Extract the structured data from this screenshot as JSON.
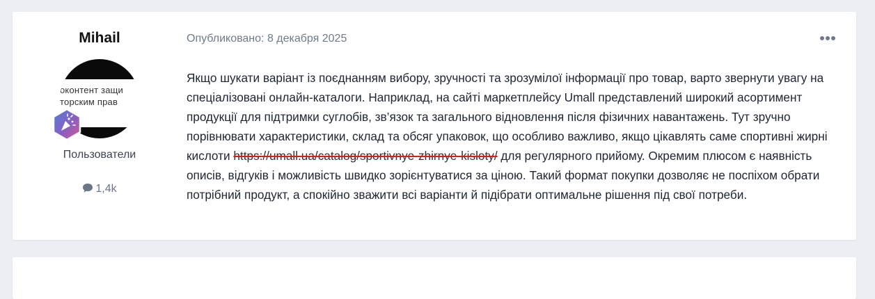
{
  "post": {
    "author": {
      "name": "Mihail",
      "avatar_text_line1": "оконтент защи",
      "avatar_text_line2": "торским прав",
      "group": "Пользователи",
      "reputation": "1,4k"
    },
    "meta": {
      "published_label": "Опубликовано:",
      "published_date": "8 декабря 2025"
    },
    "body": {
      "text_before_link": "Якщо шукати варіант із поєднанням вибору, зручності та зрозумілої інформації про товар, варто звернути увагу на спеціалізовані онлайн-каталоги. Наприклад, на сайті маркетплейсу Umall представлений широкий асортимент продукції для підтримки суглобів, зв’язок та загального відновлення після фізичних навантажень. Тут зручно порівнювати характеристики, склад та обсяг упаковок, що особливо важливо, якщо цікавлять саме спортивні жирні кислоти",
      "link_text": "https://umall.ua/catalog/sportivnye-zhirnye-kisloty/",
      "text_after_link": " для регулярного прийому. Окремим плюсом є наявність описів, відгуків і можливість швидко зорієнтуватися за ціною. Такий формат покупки дозволяє не поспіхом обрати потрібний продукт, а спокійно зважити всі варіанти й підібрати оптимальне рішення під свої потреби."
    },
    "menu_icon": "ellipsis-icon",
    "badge_icon": "confetti-badge-icon",
    "reputation_icon": "speech-bubble-icon"
  },
  "colors": {
    "page_bg": "#ebeef2",
    "card_bg": "#ffffff",
    "meta_text": "#6e7a8d",
    "link_strike": "#d21f1f"
  }
}
